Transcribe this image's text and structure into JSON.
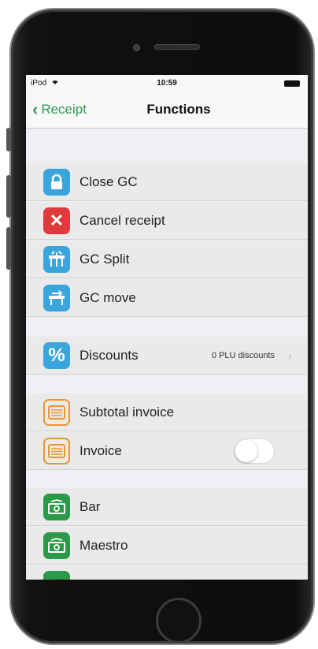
{
  "status_bar": {
    "carrier": "iPod",
    "time": "10:59"
  },
  "navbar": {
    "back_label": "Receipt",
    "title": "Functions"
  },
  "rows": [
    {
      "label": "Close GC",
      "icon": "lock-icon"
    },
    {
      "label": "Cancel receipt",
      "icon": "x-icon"
    },
    {
      "label": "GC Split",
      "icon": "table-split-icon"
    },
    {
      "label": "GC move",
      "icon": "table-move-icon"
    },
    {
      "label": "Discounts",
      "icon": "percent-icon",
      "detail": "0 PLU discounts"
    },
    {
      "label": "Subtotal invoice",
      "icon": "invoice-icon"
    },
    {
      "label": "Invoice",
      "icon": "invoice-icon",
      "toggle_on": false
    },
    {
      "label": "Bar",
      "icon": "cash-icon"
    },
    {
      "label": "Maestro",
      "icon": "cash-icon"
    }
  ],
  "icon_glyphs": {
    "percent": "%",
    "cancel": "✕"
  },
  "colors": {
    "accent": "#2e9a57",
    "blue": "#3aa5dc",
    "red": "#e03a3e",
    "orange": "#e7953a",
    "green": "#2b9a48"
  }
}
